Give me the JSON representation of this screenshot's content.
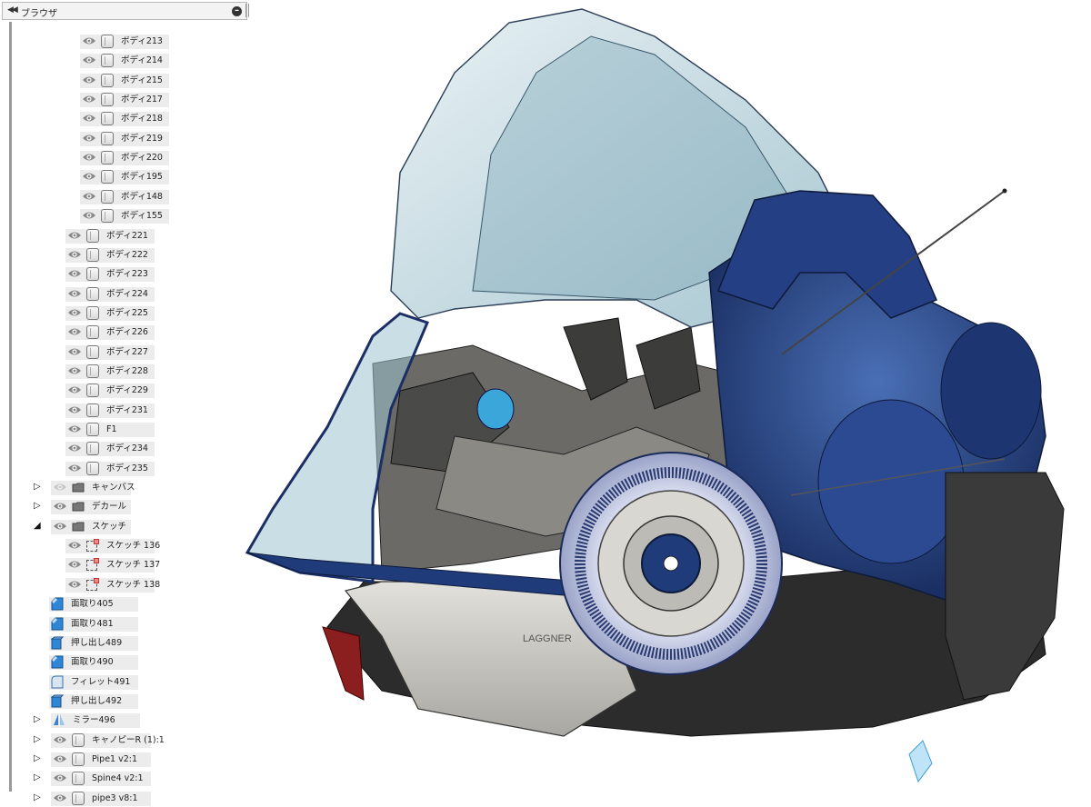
{
  "browser": {
    "title": "ブラウザ",
    "collapse_glyph": "◀◀",
    "minus_glyph": "–"
  },
  "tree": [
    {
      "label": "ボディ213",
      "type": "body",
      "indent": 2
    },
    {
      "label": "ボディ214",
      "type": "body",
      "indent": 2
    },
    {
      "label": "ボディ215",
      "type": "body",
      "indent": 2
    },
    {
      "label": "ボディ217",
      "type": "body",
      "indent": 2
    },
    {
      "label": "ボディ218",
      "type": "body",
      "indent": 2
    },
    {
      "label": "ボディ219",
      "type": "body",
      "indent": 2
    },
    {
      "label": "ボディ220",
      "type": "body",
      "indent": 2
    },
    {
      "label": "ボディ195",
      "type": "body",
      "indent": 2
    },
    {
      "label": "ボディ148",
      "type": "body",
      "indent": 2
    },
    {
      "label": "ボディ155",
      "type": "body",
      "indent": 2
    },
    {
      "label": "ボディ221",
      "type": "body",
      "indent": 1
    },
    {
      "label": "ボディ222",
      "type": "body",
      "indent": 1
    },
    {
      "label": "ボディ223",
      "type": "body",
      "indent": 1
    },
    {
      "label": "ボディ224",
      "type": "body",
      "indent": 1
    },
    {
      "label": "ボディ225",
      "type": "body",
      "indent": 1
    },
    {
      "label": "ボディ226",
      "type": "body",
      "indent": 1
    },
    {
      "label": "ボディ227",
      "type": "body",
      "indent": 1
    },
    {
      "label": "ボディ228",
      "type": "body",
      "indent": 1
    },
    {
      "label": "ボディ229",
      "type": "body",
      "indent": 1
    },
    {
      "label": "ボディ231",
      "type": "body",
      "indent": 1
    },
    {
      "label": "F1",
      "type": "body",
      "indent": 1
    },
    {
      "label": "ボディ234",
      "type": "body",
      "indent": 1
    },
    {
      "label": "ボディ235",
      "type": "body",
      "indent": 1
    },
    {
      "label": "キャンバス",
      "type": "folder",
      "indent": 0,
      "twisty": "▷",
      "eye_hidden": true
    },
    {
      "label": "デカール",
      "type": "folder",
      "indent": 0,
      "twisty": "▷"
    },
    {
      "label": "スケッチ",
      "type": "folder",
      "indent": 0,
      "twisty": "◢"
    },
    {
      "label": "スケッチ 136",
      "type": "sketch",
      "indent": 1
    },
    {
      "label": "スケッチ 137",
      "type": "sketch",
      "indent": 1
    },
    {
      "label": "スケッチ 138",
      "type": "sketch",
      "indent": 1
    },
    {
      "label": "面取り405",
      "type": "feature",
      "indent": -1
    },
    {
      "label": "面取り481",
      "type": "feature",
      "indent": -1
    },
    {
      "label": "押し出し489",
      "type": "extrude",
      "indent": -1
    },
    {
      "label": "面取り490",
      "type": "feature",
      "indent": -1
    },
    {
      "label": "フィレット491",
      "type": "fillet",
      "indent": -1
    },
    {
      "label": "押し出し492",
      "type": "extrude",
      "indent": -1
    },
    {
      "label": "ミラー496",
      "type": "mirror",
      "indent": 0,
      "twisty": "▷"
    },
    {
      "label": "キャノピーR (1):1",
      "type": "component",
      "indent": 0,
      "twisty": "▷"
    },
    {
      "label": "Pipe1 v2:1",
      "type": "component",
      "indent": 0,
      "twisty": "▷"
    },
    {
      "label": "Spine4 v2:1",
      "type": "component",
      "indent": 0,
      "twisty": "▷"
    },
    {
      "label": "pipe3 v8:1",
      "type": "component",
      "indent": 0,
      "twisty": "▷"
    }
  ],
  "model": {
    "canopy_color": "#b9d4dc",
    "hull_blue": "#1f3b7a",
    "hull_grey": "#c9c7c1",
    "dark_mech": "#3a3a3a",
    "accent_red": "#b02020",
    "decal_text": "LAGGNER"
  }
}
